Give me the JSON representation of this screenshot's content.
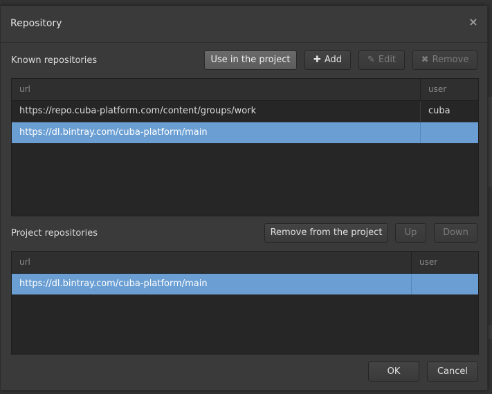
{
  "dialog": {
    "title": "Repository",
    "close_icon": "×"
  },
  "known": {
    "label": "Known repositories",
    "buttons": {
      "use_in_project": "Use in the project",
      "add": "Add",
      "add_icon": "✚",
      "edit": "Edit",
      "edit_icon": "✎",
      "remove": "Remove",
      "remove_icon": "✖"
    },
    "columns": {
      "url": "url",
      "user": "user"
    },
    "rows": [
      {
        "url": "https://repo.cuba-platform.com/content/groups/work",
        "user": "cuba",
        "selected": false
      },
      {
        "url": "https://dl.bintray.com/cuba-platform/main",
        "user": "",
        "selected": true
      }
    ]
  },
  "project": {
    "label": "Project repositories",
    "buttons": {
      "remove_from_project": "Remove from the project",
      "up": "Up",
      "down": "Down"
    },
    "columns": {
      "url": "url",
      "user": "user"
    },
    "rows": [
      {
        "url": "https://dl.bintray.com/cuba-platform/main",
        "user": "",
        "selected": true
      }
    ]
  },
  "footer": {
    "ok": "OK",
    "cancel": "Cancel"
  },
  "colors": {
    "selection": "#6b9fd3",
    "background": "#3a3a3a"
  }
}
